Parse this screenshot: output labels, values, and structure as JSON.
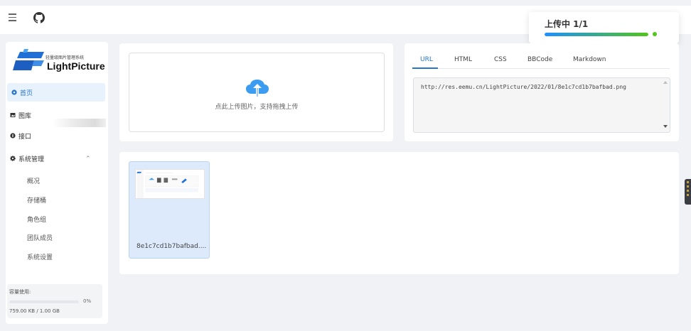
{
  "topbar": {
    "menu_icon": "hamburger-icon",
    "repo_icon": "github-icon"
  },
  "upload_toast": {
    "title": "上传中 1/1",
    "progress": 1.0,
    "status_color": "#52c41a"
  },
  "sidebar": {
    "logo": {
      "subtitle": "轻量级图片管理系统",
      "name": "LightPicture"
    },
    "items": [
      {
        "label": "首页",
        "icon": "home-icon",
        "active": true
      },
      {
        "label": "图库",
        "icon": "image-icon"
      },
      {
        "label": "接口",
        "icon": "api-icon"
      },
      {
        "label": "系统管理",
        "icon": "gear-icon",
        "expanded": true
      }
    ],
    "sub_items": [
      {
        "label": "概况"
      },
      {
        "label": "存储桶"
      },
      {
        "label": "角色组"
      },
      {
        "label": "团队成员"
      },
      {
        "label": "系统设置"
      }
    ],
    "storage": {
      "label": "容量使用:",
      "percent": "0%",
      "used": "759.00 KB / 1.00 GB"
    }
  },
  "upload": {
    "hint": "点此上传图片，支持拖拽上传"
  },
  "links": {
    "tabs": [
      "URL",
      "HTML",
      "CSS",
      "BBCode",
      "Markdown"
    ],
    "active_tab": "URL",
    "value": "http://res.eemu.cn/LightPicture/2022/01/8e1c7cd1b7bafbad.png"
  },
  "gallery": {
    "items": [
      {
        "name": "8e1c7cd1b7bafbad...."
      }
    ]
  },
  "colors": {
    "accent": "#2a76c6",
    "active_bg": "#e8f2fc",
    "card_bg": "#dceafb"
  }
}
